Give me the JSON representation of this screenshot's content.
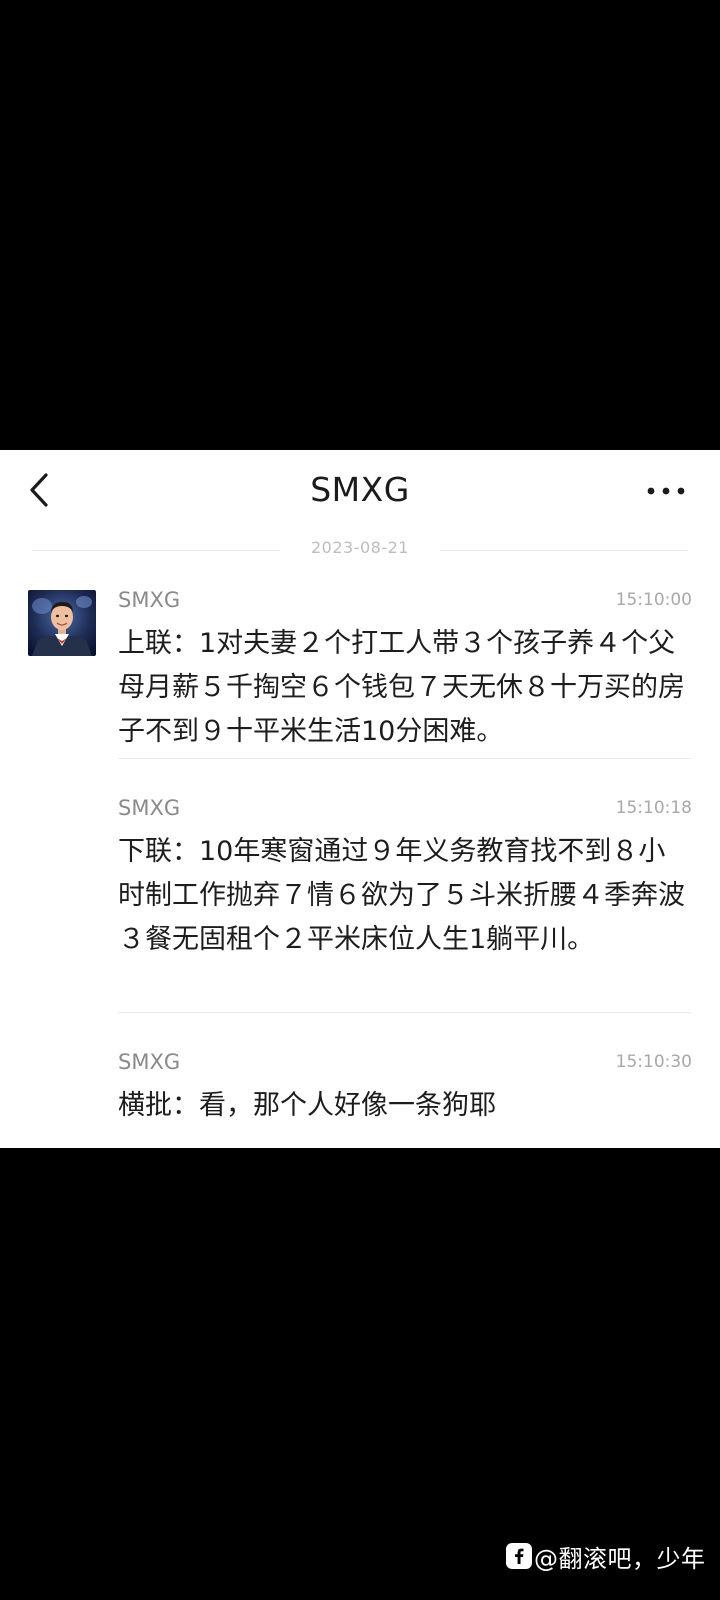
{
  "header": {
    "title": "SMXG",
    "back_icon": "chevron-left-icon",
    "more_icon": "more-horizontal-icon"
  },
  "date_separator": "2023-08-21",
  "messages": [
    {
      "sender": "SMXG",
      "time": "15:10:00",
      "text": "上联：1对夫妻２个打工人带３个孩子养４个父母月薪５千掏空６个钱包７天无休８十万买的房子不到９十平米生活10分困难。"
    },
    {
      "sender": "SMXG",
      "time": "15:10:18",
      "text": "下联：10年寒窗通过９年义务教育找不到８小时制工作抛弃７情６欲为了５斗米折腰４季奔波３餐无固租个２平米床位人生1躺平川。"
    },
    {
      "sender": "SMXG",
      "time": "15:10:30",
      "text": "横批：看，那个人好像一条狗耶"
    }
  ],
  "watermark": {
    "logo_icon": "social-logo-icon",
    "text": "@翻滚吧，少年"
  }
}
